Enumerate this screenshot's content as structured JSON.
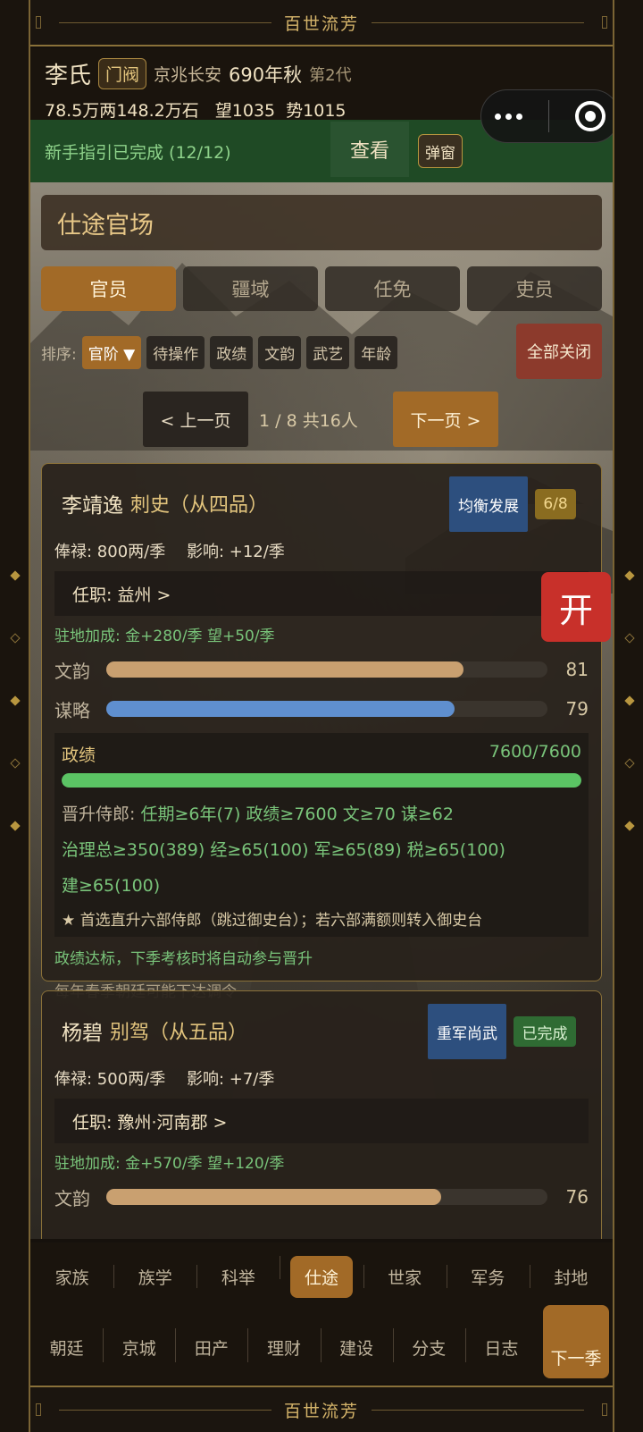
{
  "banner": {
    "title": "百世流芳"
  },
  "header": {
    "clan": "李氏",
    "gate_tag": "门阀",
    "location": "京兆长安",
    "season": "690年秋",
    "generation": "第2代",
    "silver": "78.5万两",
    "grain": "148.2万石",
    "prestige": "望1035",
    "power": "势1015"
  },
  "guide": {
    "text": "新手指引已完成 (12/12)",
    "view": "查看",
    "popup": "弹窗"
  },
  "section_title": "仕途官场",
  "tabs": [
    {
      "label": "官员",
      "active": true
    },
    {
      "label": "疆域",
      "active": false
    },
    {
      "label": "任免",
      "active": false
    },
    {
      "label": "吏员",
      "active": false
    }
  ],
  "sort": {
    "label": "排序:",
    "options": [
      "官阶 ▼",
      "待操作",
      "政绩",
      "文韵",
      "武艺",
      "年龄"
    ],
    "close_all": "全部关闭"
  },
  "pager": {
    "prev": "< 上一页",
    "info": "1 / 8  共16人",
    "next": "下一页 >"
  },
  "officials": [
    {
      "name": "李靖逸",
      "rank": "刺史（从四品）",
      "strategy_tag": "均衡发展",
      "progress_tag": "6/8",
      "salary": "俸禄: 800两/季",
      "influence": "影响: +12/季",
      "post": "任职: 益州  >",
      "bonus": "驻地加成: 金+280/季  望+50/季",
      "stats": [
        {
          "label": "文韵",
          "value": 81,
          "fraction": 0.81
        },
        {
          "label": "谋略",
          "value": 79,
          "fraction": 0.79
        }
      ],
      "performance": {
        "label": "政绩",
        "value": "7600/7600",
        "fraction": 1.0,
        "promote_label": "晋升侍郎:",
        "promote_req": "任期≥6年(7)  政绩≥7600  文≥70  谋≥62",
        "req_line2": "治理总≥350(389)  经≥65(100)  军≥65(89)  税≥65(100)",
        "req_line3": "建≥65(100)",
        "note": "★ 首选直升六部侍郎（跳过御史台）；若六部满额则转入御史台"
      },
      "ok_line": "政绩达标，下季考核时将自动参与晋升",
      "muted_line": "每年春季朝廷可能下达调令"
    },
    {
      "name": "杨碧",
      "rank": "别驾（从五品）",
      "strategy_tag": "重军尚武",
      "progress_tag": "已完成",
      "salary": "俸禄: 500两/季",
      "influence": "影响: +7/季",
      "post": "任职: 豫州·河南郡  >",
      "bonus": "驻地加成: 金+570/季  望+120/季",
      "stats": [
        {
          "label": "文韵",
          "value": 76,
          "fraction": 0.76
        }
      ]
    }
  ],
  "open_button": "开",
  "nav_primary": [
    {
      "label": "家族",
      "active": false
    },
    {
      "label": "族学",
      "active": false
    },
    {
      "label": "科举",
      "active": false
    },
    {
      "label": "仕途",
      "active": true
    },
    {
      "label": "世家",
      "active": false
    },
    {
      "label": "军务",
      "active": false
    },
    {
      "label": "封地",
      "active": false
    }
  ],
  "nav_secondary": [
    "朝廷",
    "京城",
    "田产",
    "理财",
    "建设",
    "分支",
    "日志"
  ],
  "next_season": "下一季"
}
